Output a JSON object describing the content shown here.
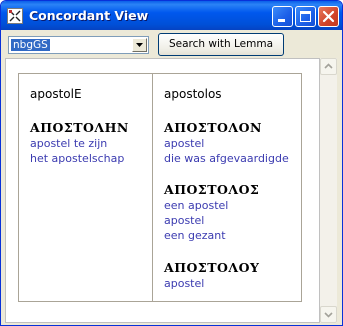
{
  "window": {
    "title": "Concordant View"
  },
  "toolbar": {
    "version_select": {
      "value": "nbgGS"
    },
    "search_button_label": "Search with Lemma"
  },
  "concordance": {
    "left": {
      "headword": "apostolE",
      "entries": [
        {
          "greek": "ΑΠΟΣΤΟΛΗΝ",
          "glosses": [
            "apostel te zijn",
            "het apostelschap"
          ]
        }
      ]
    },
    "right": {
      "headword": "apostolos",
      "entries": [
        {
          "greek": "ΑΠΟΣΤΟΛΟΝ",
          "glosses": [
            "apostel",
            "die was afgevaardigde"
          ]
        },
        {
          "greek": "ΑΠΟΣΤΟΛΟΣ",
          "glosses": [
            "een apostel",
            "apostel",
            "een gezant"
          ]
        },
        {
          "greek": "ΑΠΟΣΤΟΛΟΥ",
          "glosses": [
            "apostel"
          ]
        }
      ]
    }
  },
  "colors": {
    "title_bar": "#0058ee",
    "gloss_text": "#3b3bb0",
    "selection": "#316ac5"
  }
}
